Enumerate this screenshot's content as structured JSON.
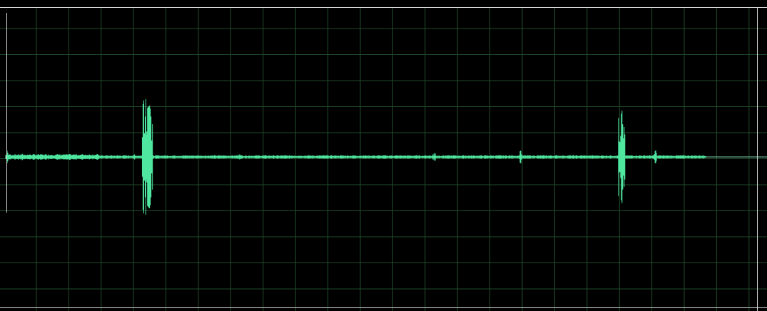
{
  "colors": {
    "background": "#000000",
    "grid": "#1f4a2a",
    "waveform": "#4fe6a0",
    "border": "#d8d8d8",
    "zero_line": "#7fd9b0"
  },
  "waveform": {
    "baseline_amplitude": 0.0,
    "events": [
      {
        "time": 0.0,
        "amplitude": 0.05,
        "label": ""
      },
      {
        "time": 0.02,
        "amplitude": 0.025,
        "label": ""
      },
      {
        "time": 0.08,
        "amplitude": 0.02,
        "label": ""
      },
      {
        "time": 0.17,
        "amplitude": 0.02,
        "label": ""
      },
      {
        "time": 0.185,
        "amplitude": 0.45,
        "label": ""
      },
      {
        "time": 0.19,
        "amplitude": 0.4,
        "label": ""
      },
      {
        "time": 0.31,
        "amplitude": 0.02,
        "label": ""
      },
      {
        "time": 0.57,
        "amplitude": 0.03,
        "label": ""
      },
      {
        "time": 0.685,
        "amplitude": 0.05,
        "label": ""
      },
      {
        "time": 0.82,
        "amplitude": 0.36,
        "label": ""
      },
      {
        "time": 0.865,
        "amplitude": 0.05,
        "label": ""
      }
    ]
  }
}
